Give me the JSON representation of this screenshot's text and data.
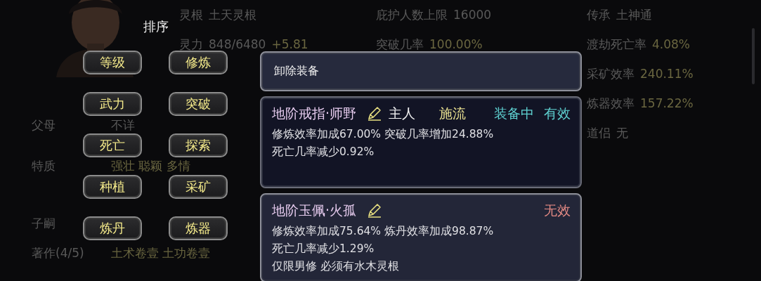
{
  "profile": {
    "left_rows": [
      {
        "label": "父母",
        "value": "不详",
        "highlight": false
      },
      {
        "label": "特质",
        "value": "强壮 聪颖 多情",
        "highlight": true
      },
      {
        "label": "子嗣"
      },
      {
        "label": "著作(4/5)",
        "value": "土术卷壹 土功卷壹",
        "highlight": true
      }
    ],
    "columns": [
      [
        {
          "label": "灵根",
          "value": "土天灵根",
          "highlight": false
        },
        {
          "label": "灵力",
          "value": "848/6480",
          "bonus": "+5.81",
          "highlight": false
        }
      ],
      [
        {
          "label": "庇护人数上限",
          "value": "16000",
          "highlight": false
        },
        {
          "label": "突破几率",
          "value": "100.00%",
          "highlight": true
        }
      ],
      [
        {
          "label": "传承",
          "value": "土神通",
          "highlight": false
        },
        {
          "label": "渡劫死亡率",
          "value": "4.08%",
          "highlight": true
        },
        {
          "label": "采矿效率",
          "value": "240.11%",
          "highlight": true
        },
        {
          "label": "炼器效率",
          "value": "157.22%",
          "highlight": true
        },
        {
          "label": "道侣",
          "value": "无",
          "highlight": false
        }
      ]
    ]
  },
  "sort_panel": {
    "title": "排序",
    "buttons": [
      "等级",
      "修炼",
      "武力",
      "突破",
      "死亡",
      "探索",
      "种植",
      "采矿",
      "炼丹",
      "炼器"
    ]
  },
  "equipment": {
    "unequip_button": "卸除装备",
    "items": [
      {
        "name": "地阶戒指·师野",
        "owner": "主人",
        "school": "施流",
        "tag": "装备中",
        "validity": "有效",
        "valid": true,
        "selected": false,
        "effects": [
          "修炼效率加成67.00% 突破几率增加24.88%",
          "死亡几率减少0.92%"
        ]
      },
      {
        "name": "地阶玉佩·火孤",
        "validity": "无效",
        "valid": false,
        "selected": true,
        "effects": [
          "修炼效率加成75.64% 炼丹效率加成98.87%",
          "死亡几率减少1.29%",
          "仅限男修 必须有水木灵根"
        ]
      }
    ]
  }
}
